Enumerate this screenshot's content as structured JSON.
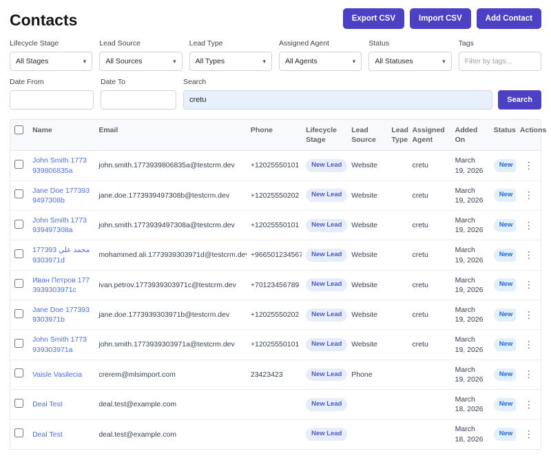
{
  "page": {
    "title": "Contacts"
  },
  "colors": {
    "accent": "#4c40c4",
    "link": "#4c6ef5",
    "lead_badge_bg": "#e8edfb",
    "lead_badge_text": "#4558d6",
    "status_badge_bg": "#e1effe",
    "status_badge_text": "#1d6ae5",
    "search_input_bg": "#e8f0fe"
  },
  "toolbar": {
    "export_csv": "Export CSV",
    "import_csv": "Import CSV",
    "add_contact": "Add Contact"
  },
  "filters": {
    "lifecycle_stage": {
      "label": "Lifecycle Stage",
      "value": "All Stages"
    },
    "lead_source": {
      "label": "Lead Source",
      "value": "All Sources"
    },
    "lead_type": {
      "label": "Lead Type",
      "value": "All Types"
    },
    "assigned_agent": {
      "label": "Assigned Agent",
      "value": "All Agents"
    },
    "status": {
      "label": "Status",
      "value": "All Statuses"
    },
    "tags": {
      "label": "Tags",
      "placeholder": "Filter by tags..."
    },
    "date_from": {
      "label": "Date From",
      "value": ""
    },
    "date_to": {
      "label": "Date To",
      "value": ""
    },
    "search": {
      "label": "Search",
      "value": "cretu",
      "button_label": "Search"
    }
  },
  "table": {
    "headers": [
      "Name",
      "Email",
      "Phone",
      "Lifecycle Stage",
      "Lead Source",
      "Lead Type",
      "Assigned Agent",
      "Added On",
      "Status",
      "Actions"
    ],
    "rows": [
      {
        "name": "John Smith",
        "id": "1773939806835a",
        "email": "john.smith.1773939806835a@testcrm.dev",
        "phone": "+12025550101",
        "lifecycle": "New Lead",
        "source": "Website",
        "type": "",
        "agent": "cretu",
        "added": "March 19, 2026",
        "status": "New"
      },
      {
        "name": "Jane Doe",
        "id": "1773939497308b",
        "email": "jane.doe.1773939497308b@testcrm.dev",
        "phone": "+12025550202",
        "lifecycle": "New Lead",
        "source": "Website",
        "type": "",
        "agent": "cretu",
        "added": "March 19, 2026",
        "status": "New"
      },
      {
        "name": "John Smith",
        "id": "1773939497308a",
        "email": "john.smith.1773939497308a@testcrm.dev",
        "phone": "+12025550101",
        "lifecycle": "New Lead",
        "source": "Website",
        "type": "",
        "agent": "cretu",
        "added": "March 19, 2026",
        "status": "New"
      },
      {
        "name": "محمد علي",
        "id": "1773939303971d",
        "email": "mohammed.ali.1773939303971d@testcrm.dev",
        "phone": "+966501234567",
        "lifecycle": "New Lead",
        "source": "Website",
        "type": "",
        "agent": "cretu",
        "added": "March 19, 2026",
        "status": "New"
      },
      {
        "name": "Иван Петров",
        "id": "1773939303971c",
        "email": "ivan.petrov.1773939303971c@testcrm.dev",
        "phone": "+70123456789",
        "lifecycle": "New Lead",
        "source": "Website",
        "type": "",
        "agent": "cretu",
        "added": "March 19, 2026",
        "status": "New"
      },
      {
        "name": "Jane Doe",
        "id": "1773939303971b",
        "email": "jane.doe.1773939303971b@testcrm.dev",
        "phone": "+12025550202",
        "lifecycle": "New Lead",
        "source": "Website",
        "type": "",
        "agent": "cretu",
        "added": "March 19, 2026",
        "status": "New"
      },
      {
        "name": "John Smith",
        "id": "1773939303971a",
        "email": "john.smith.1773939303971a@testcrm.dev",
        "phone": "+12025550101",
        "lifecycle": "New Lead",
        "source": "Website",
        "type": "",
        "agent": "cretu",
        "added": "March 19, 2026",
        "status": "New"
      },
      {
        "name": "Vaisle Vasilecia",
        "id": "",
        "email": "crerem@mlsimport.com",
        "phone": "23423423",
        "lifecycle": "New Lead",
        "source": "Phone",
        "type": "",
        "agent": "",
        "added": "March 19, 2026",
        "status": "New"
      },
      {
        "name": "Deal Test",
        "id": "",
        "email": "deal.test@example.com",
        "phone": "",
        "lifecycle": "New Lead",
        "source": "",
        "type": "",
        "agent": "",
        "added": "March 18, 2026",
        "status": "New"
      },
      {
        "name": "Deal Test",
        "id": "",
        "email": "deal.test@example.com",
        "phone": "",
        "lifecycle": "New Lead",
        "source": "",
        "type": "",
        "agent": "",
        "added": "March 18, 2026",
        "status": "New"
      }
    ]
  }
}
